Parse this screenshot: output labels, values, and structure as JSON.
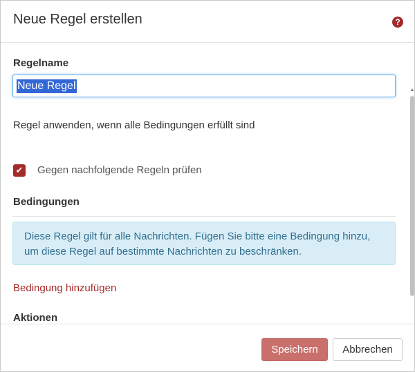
{
  "dialog": {
    "title": "Neue Regel erstellen",
    "help_icon": "question-circle-icon",
    "help_symbol": "?"
  },
  "form": {
    "rule_name_label": "Regelname",
    "rule_name_value": "Neue Regel",
    "apply_text": "Regel anwenden, wenn alle Bedingungen erfüllt sind",
    "checkbox_checked": true,
    "checkbox_mark": "✔",
    "checkbox_label": "Gegen nachfolgende Regeln prüfen",
    "conditions_heading": "Bedingungen",
    "info_text": "Diese Regel gilt für alle Nachrichten. Fügen Sie bitte eine Bedingung hinzu, um diese Regel auf bestimmte Nachrichten zu beschränken.",
    "add_condition_link": "Bedingung hinzufügen",
    "actions_heading": "Aktionen"
  },
  "footer": {
    "save_label": "Speichern",
    "cancel_label": "Abbrechen"
  },
  "colors": {
    "accent": "#a52a2a",
    "save_button": "#c9706c",
    "info_bg": "#d9edf7",
    "info_text": "#31708f"
  }
}
